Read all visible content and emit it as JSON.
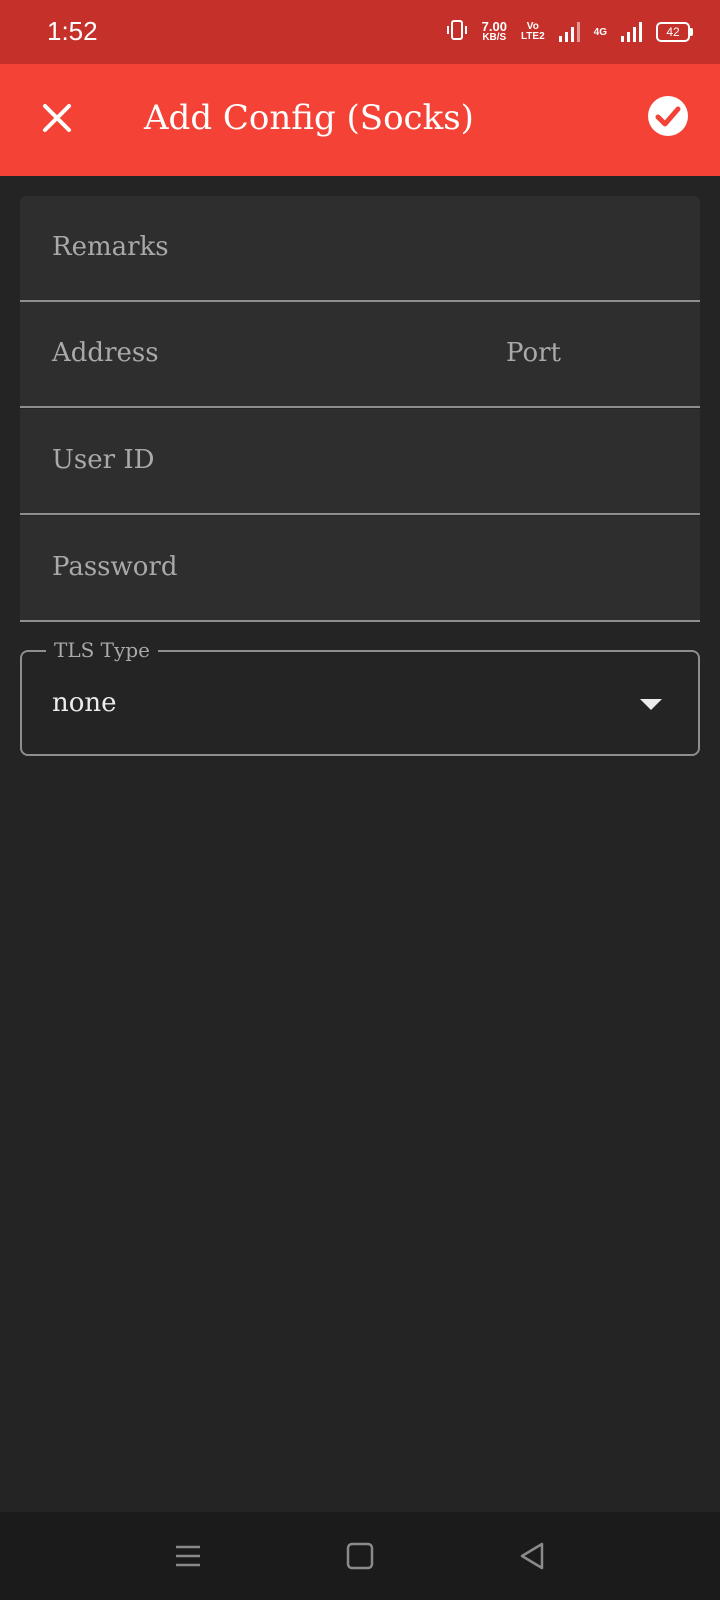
{
  "status_bar": {
    "time": "1:52",
    "speed_value": "7.00",
    "speed_unit": "KB/S",
    "volte_top": "Vo",
    "volte_bottom": "LTE2",
    "network": "4G",
    "battery": "42",
    "icons": [
      "vibrate-icon",
      "signal-icon",
      "signal-icon",
      "battery-icon"
    ]
  },
  "app_bar": {
    "title": "Add Config (Socks)",
    "close_icon": "close-icon",
    "save_icon": "check-circle-icon",
    "color": "#f44336"
  },
  "form": {
    "remarks_label": "Remarks",
    "address_label": "Address",
    "port_label": "Port",
    "user_id_label": "User ID",
    "password_label": "Password"
  },
  "tls": {
    "legend": "TLS Type",
    "value": "none",
    "icon": "dropdown-arrow-icon"
  },
  "nav_bar": {
    "icons": [
      "menu-icon",
      "home-icon",
      "back-icon"
    ]
  }
}
